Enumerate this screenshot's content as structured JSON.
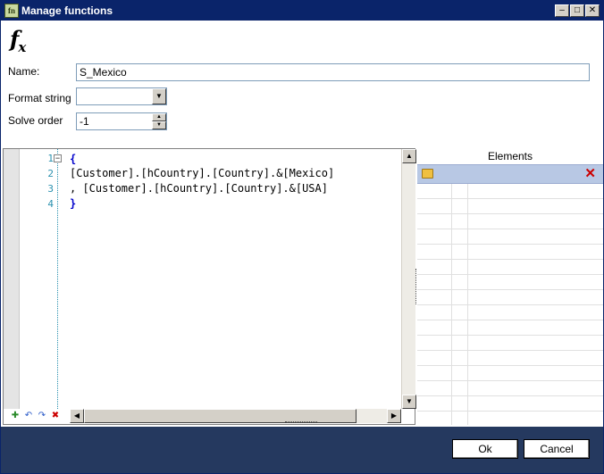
{
  "window": {
    "title": "Manage functions",
    "icon": "fx-app-icon",
    "controls": [
      "minimize",
      "maximize",
      "close"
    ]
  },
  "form": {
    "name_label": "Name:",
    "name_value": "S_Mexico",
    "format_label": "Format string",
    "format_value": "",
    "solve_label": "Solve order",
    "solve_value": "-1"
  },
  "editor": {
    "lines": [
      {
        "num": "1",
        "text": "{"
      },
      {
        "num": "2",
        "text": "[Customer].[hCountry].[Country].&[Mexico]"
      },
      {
        "num": "3",
        "text": ", [Customer].[hCountry].[Country].&[USA]"
      },
      {
        "num": "4",
        "text": "}"
      }
    ],
    "toolbar_icons": [
      "add-icon",
      "undo-icon",
      "redo-icon",
      "delete-icon"
    ]
  },
  "elements": {
    "header": "Elements",
    "toolbar_icons": [
      "folder-icon",
      "delete-icon"
    ],
    "colors": {
      "toolbar": "#b8c8e4"
    }
  },
  "footer": {
    "ok_label": "Ok",
    "cancel_label": "Cancel",
    "colors": {
      "background": "#25395f"
    }
  }
}
